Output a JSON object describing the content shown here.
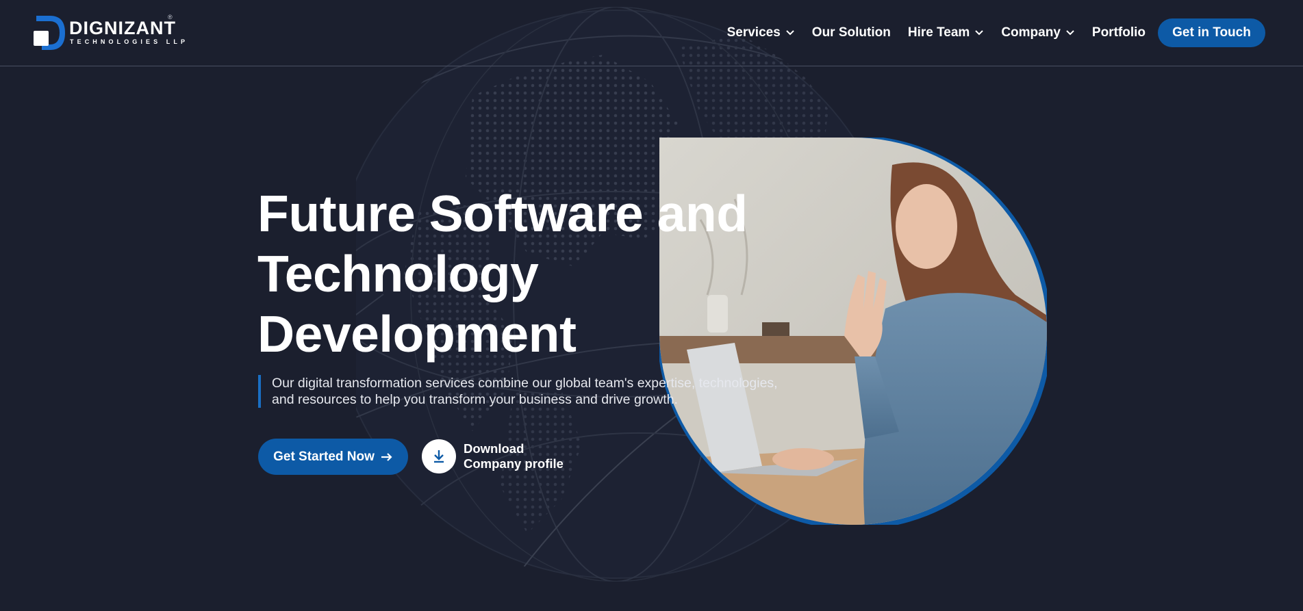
{
  "brand": {
    "name": "DIGNIZANT",
    "tagline": "TECHNOLOGIES LLP",
    "registered_mark": "®",
    "accent_color": "#0d5aa6",
    "background_color": "#1b1f2e"
  },
  "nav": {
    "items": [
      {
        "label": "Services",
        "has_dropdown": true
      },
      {
        "label": "Our Solution",
        "has_dropdown": false
      },
      {
        "label": "Hire Team",
        "has_dropdown": true
      },
      {
        "label": "Company",
        "has_dropdown": true
      },
      {
        "label": "Portfolio",
        "has_dropdown": false
      }
    ],
    "cta_label": "Get in Touch"
  },
  "hero": {
    "title_lines": [
      "Future Software and",
      "Technology",
      "Development"
    ],
    "description": "Our digital transformation services combine our global team's expertise, technologies, and resources to help you transform your business and drive growth.",
    "primary_button": "Get Started Now",
    "download_lines": [
      "Download",
      "Company profile"
    ]
  }
}
